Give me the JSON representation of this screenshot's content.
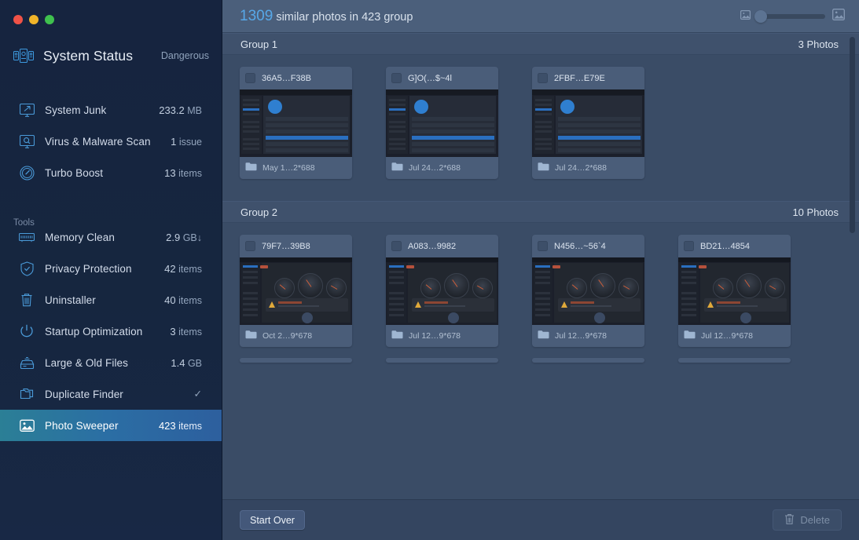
{
  "window": {
    "traffic_lights": [
      "close",
      "minimize",
      "maximize"
    ]
  },
  "sidebar": {
    "status": {
      "icon": "system-status-icon",
      "title": "System Status",
      "value": "Dangerous"
    },
    "main_items": [
      {
        "icon": "monitor-junk-icon",
        "label": "System Junk",
        "value_num": "233.2",
        "value_unit": "MB"
      },
      {
        "icon": "virus-scan-icon",
        "label": "Virus & Malware Scan",
        "value_num": "1",
        "value_unit": "issue"
      },
      {
        "icon": "turbo-boost-icon",
        "label": "Turbo Boost",
        "value_num": "13",
        "value_unit": "items"
      }
    ],
    "tools_label": "Tools",
    "tool_items": [
      {
        "icon": "memory-icon",
        "label": "Memory Clean",
        "value_num": "2.9",
        "value_unit": "GB↓",
        "selected": false
      },
      {
        "icon": "shield-icon",
        "label": "Privacy Protection",
        "value_num": "42",
        "value_unit": "items",
        "selected": false
      },
      {
        "icon": "trash-icon",
        "label": "Uninstaller",
        "value_num": "40",
        "value_unit": "items",
        "selected": false
      },
      {
        "icon": "power-icon",
        "label": "Startup Optimization",
        "value_num": "3",
        "value_unit": "items",
        "selected": false
      },
      {
        "icon": "files-icon",
        "label": "Large & Old Files",
        "value_num": "1.4",
        "value_unit": "GB",
        "selected": false
      },
      {
        "icon": "duplicate-icon",
        "label": "Duplicate Finder",
        "value_num": "",
        "value_unit": "✓",
        "selected": false
      },
      {
        "icon": "photo-icon",
        "label": "Photo Sweeper",
        "value_num": "423",
        "value_unit": "items",
        "selected": true
      }
    ]
  },
  "topbar": {
    "count": "1309",
    "title_rest": "similar photos in 423 group",
    "small_photo_icon": "small-photo-icon",
    "large_photo_icon": "large-photo-icon",
    "slider_value": 0
  },
  "groups": [
    {
      "name": "Group 1",
      "count": "3 Photos",
      "thumb_style": "list-app",
      "photos": [
        {
          "title": "36A5…F38B",
          "subtitle": "May 1…2*688",
          "checked": false
        },
        {
          "title": "G]O(…$~4l",
          "subtitle": "Jul 24…2*688",
          "checked": false
        },
        {
          "title": "2FBF…E79E",
          "subtitle": "Jul 24…2*688",
          "checked": false
        }
      ]
    },
    {
      "name": "Group 2",
      "count": "10 Photos",
      "thumb_style": "gauges",
      "photos": [
        {
          "title": "79F7…39B8",
          "subtitle": "Oct 2…9*678",
          "checked": false
        },
        {
          "title": "A083…9982",
          "subtitle": "Jul 12…9*678",
          "checked": false
        },
        {
          "title": "N456…~56`4",
          "subtitle": "Jul 12…9*678",
          "checked": false
        },
        {
          "title": "BD21…4854",
          "subtitle": "Jul 12…9*678",
          "checked": false
        }
      ]
    }
  ],
  "footer": {
    "start_over_label": "Start Over",
    "delete_label": "Delete",
    "delete_icon": "trash-icon",
    "delete_disabled": true
  },
  "colors": {
    "accent_blue": "#57a8e8",
    "selected_start": "#2b7f96",
    "selected_end": "#2d5f9e",
    "sidebar_bg": "#16243f",
    "main_bg": "#3a4c66",
    "card_bg": "#4a5d79"
  }
}
